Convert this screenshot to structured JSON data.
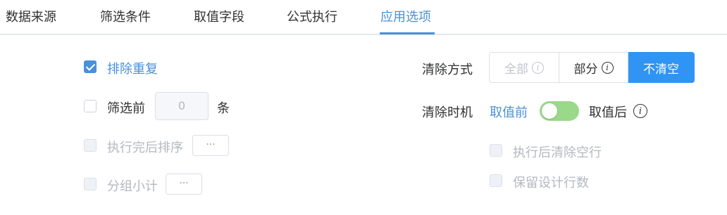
{
  "tabs": [
    {
      "label": "数据来源"
    },
    {
      "label": "筛选条件"
    },
    {
      "label": "取值字段"
    },
    {
      "label": "公式执行"
    },
    {
      "label": "应用选项"
    }
  ],
  "active_tab": "应用选项",
  "accent_color": "#4a90d9",
  "left": {
    "dedupe": {
      "label": "排除重复",
      "checked": true
    },
    "filter_before": {
      "label": "筛选前",
      "value": "0",
      "unit": "条",
      "checked": false
    },
    "sort_after": {
      "label": "执行完后排序",
      "button": "···",
      "checked": false,
      "disabled": true
    },
    "group_subtotal": {
      "label": "分组小计",
      "button": "···",
      "checked": false,
      "disabled": true
    }
  },
  "right": {
    "clear_mode": {
      "label": "清除方式",
      "options": [
        {
          "label": "全部",
          "icon": "info-icon"
        },
        {
          "label": "部分",
          "icon": "info-icon"
        },
        {
          "label": "不清空"
        }
      ],
      "selected": "不清空"
    },
    "clear_timing": {
      "label": "清除时机",
      "left_option": "取值前",
      "right_option": "取值后",
      "icon": "info-icon"
    },
    "clear_empty_rows": {
      "label": "执行后清除空行",
      "checked": false,
      "disabled": true
    },
    "keep_design_rows": {
      "label": "保留设计行数",
      "checked": false,
      "disabled": true
    }
  },
  "info_glyph": "i"
}
